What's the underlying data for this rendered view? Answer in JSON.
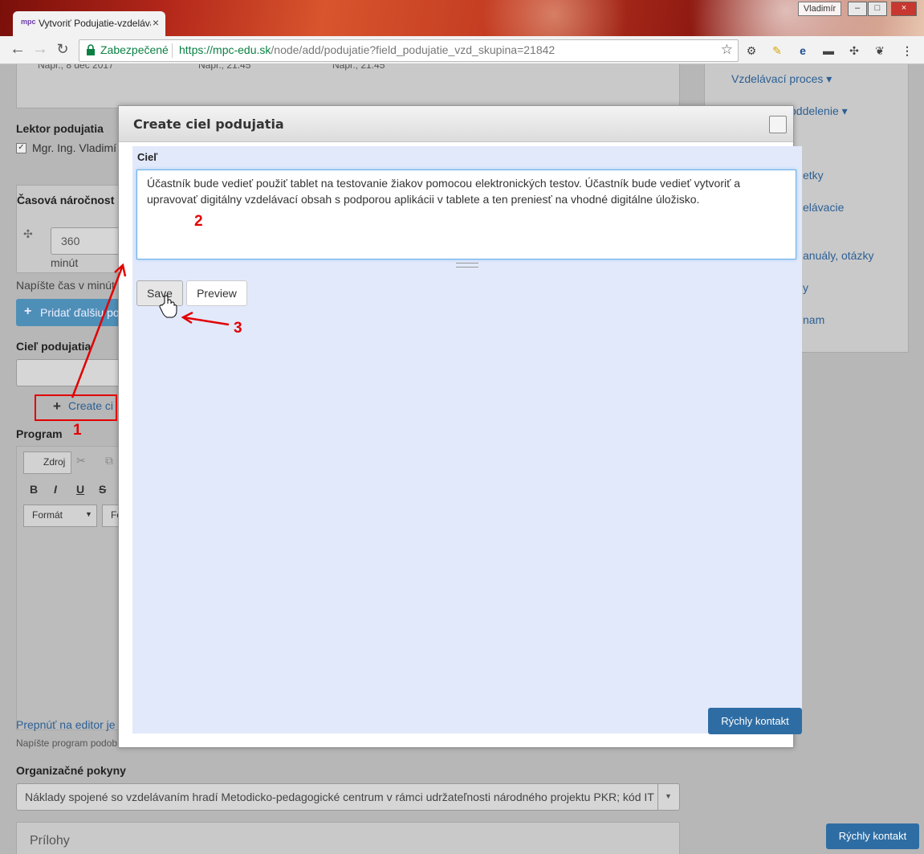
{
  "browser": {
    "tab_logo": "mpc",
    "tab_title": "Vytvoriť Podujatie-vzdelávanie",
    "user_name": "Vladimír",
    "secure_label": "Zabezpečené",
    "url_scheme": "https://",
    "url_host": "mpc-edu.sk",
    "url_path": "/node/add/podujatie?field_podujatie_vzd_skupina=21842"
  },
  "page": {
    "top_hint_1": "Napr., 8 dec 2017",
    "top_hint_2": "Napr., 21:45",
    "top_hint_3": "Napr., 21:45",
    "lektor_label": "Lektor podujatia",
    "lektor_name": "Mgr. Ing. Vladimí",
    "casova_label": "Časová náročnost",
    "minutes_value": "360",
    "minutes_unit": "minút",
    "time_hint": "Napíšte čas v minút",
    "add_more_button": "Pridať ďalšiu po",
    "ciel_label": "Cieľ podujatia",
    "create_link": "Create ci",
    "program_label": "Program",
    "editor_source": "Zdroj",
    "editor_format": "Formát",
    "editor_font": "Fo",
    "switch_editor": "Prepnúť na editor je",
    "program_hint": "Napíšte program podob",
    "org_label": "Organizačné pokyny",
    "org_value": "Náklady spojené so vzdelávaním hradí Metodicko-pedagogické centrum v rámci udržateľnosti národného projektu PKR; kód IT",
    "prilohy_label": "Prílohy"
  },
  "sidebar": {
    "items": [
      "Vzdelávací proces",
      "oddelenie",
      "etky",
      "elávacie",
      "anuály, otázky",
      "y",
      "nam"
    ]
  },
  "dialog": {
    "title": "Create ciel podujatia",
    "field_label": "Cieľ",
    "textarea_value": "Účastník bude vedieť použiť tablet na testovanie žiakov pomocou elektronických testov. Účastník bude vedieť vytvoriť a upravovať digitálny vzdelávací obsah s podporou aplikácii v tablete a ten preniesť na vhodné digitálne úložisko.",
    "save_label": "Save",
    "preview_label": "Preview",
    "quick_contact": "Rýchly kontakt"
  },
  "quick_contact": "Rýchly kontakt",
  "annotations": {
    "n1": "1",
    "n2": "2",
    "n3": "3"
  },
  "colors": {
    "accent": "#2e6da4",
    "annotation": "#e20000",
    "secure": "#0b8043"
  }
}
